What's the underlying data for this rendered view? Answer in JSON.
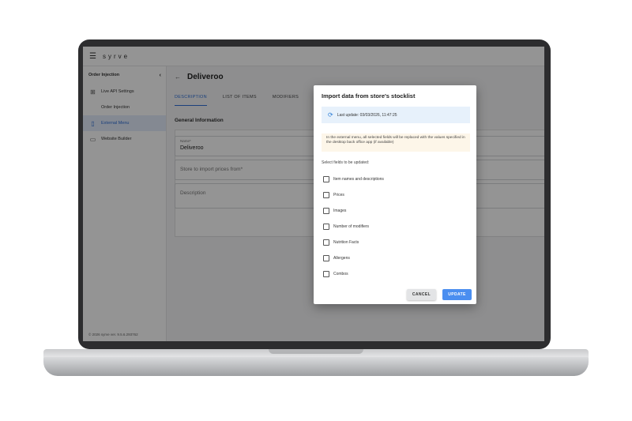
{
  "app": {
    "brand": "syrve",
    "menu_icon": "hamburger-icon"
  },
  "sidebar": {
    "header": "Order Injection",
    "collapse_icon": "chevron-left-icon",
    "items": [
      {
        "label": "Live API Settings",
        "icon": "api-icon"
      },
      {
        "label": "Order Injection",
        "icon": ""
      },
      {
        "label": "External Menu",
        "icon": "menu-book-icon",
        "active": true
      },
      {
        "label": "Website Builder",
        "icon": "website-icon"
      }
    ],
    "footer": "© 2026 syrve    ver. 9.5.6.293762"
  },
  "page": {
    "back_icon": "arrow-left-icon",
    "title": "Deliveroo",
    "tabs": [
      {
        "label": "DESCRIPTION",
        "active": true
      },
      {
        "label": "LIST OF ITEMS"
      },
      {
        "label": "MODIFIERS"
      }
    ],
    "section_title": "General Information",
    "fields": {
      "name_label": "Name*",
      "name_value": "Deliveroo",
      "store_placeholder": "Store to import prices from*",
      "description_placeholder": "Description"
    }
  },
  "dialog": {
    "title": "Import data from store's stocklist",
    "last_update_icon": "sync-icon",
    "last_update": "Last update: 03/03/2026, 11:47:25",
    "warning": "In the external menu, all selected fields will be replaced with the values specified in the desktop back office app (if available)",
    "select_label": "Select fields to be updated:",
    "options": [
      {
        "label": "Item names and descriptions",
        "checked": false
      },
      {
        "label": "Prices",
        "checked": false
      },
      {
        "label": "Images",
        "checked": false
      },
      {
        "label": "Number of modifiers",
        "checked": false
      },
      {
        "label": "Nutrition Facts",
        "checked": false
      },
      {
        "label": "Allergens",
        "checked": false
      },
      {
        "label": "Combos",
        "checked": false
      }
    ],
    "cancel_label": "CANCEL",
    "update_label": "UPDATE"
  },
  "colors": {
    "accent": "#4a8ef0",
    "active_bg": "#e3ecfb",
    "info_bg": "#e7f1fb",
    "warn_bg": "#fdf6e9"
  }
}
